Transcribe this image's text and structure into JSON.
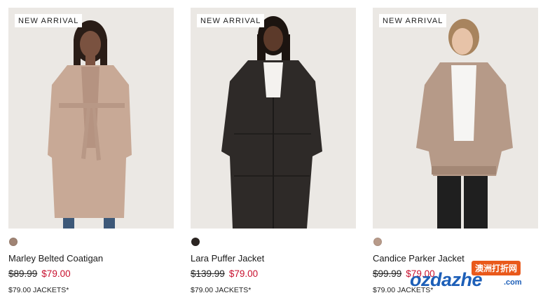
{
  "products": [
    {
      "badge": "NEW ARRIVAL",
      "name": "Marley Belted Coatigan",
      "was_price": "$89.99",
      "sale_price": "$79.00",
      "promo": "$79.00 JACKETS*",
      "swatch_color": "#a08474",
      "garment_color": "#c8a996"
    },
    {
      "badge": "NEW ARRIVAL",
      "name": "Lara Puffer Jacket",
      "was_price": "$139.99",
      "sale_price": "$79.00",
      "promo": "$79.00 JACKETS*",
      "swatch_color": "#2b2522",
      "garment_color": "#2e2a28"
    },
    {
      "badge": "NEW ARRIVAL",
      "name": "Candice Parker Jacket",
      "was_price": "$99.99",
      "sale_price": "$79.00",
      "promo": "$79.00 JACKETS*",
      "swatch_color": "#b89b8a",
      "garment_color": "#b69a88"
    }
  ],
  "watermark": {
    "cn": "澳洲打折网",
    "main": "ozdazhe",
    "domain": ".com"
  },
  "colors": {
    "sale_red": "#c8102e",
    "watermark_blue": "#1d5fb8",
    "watermark_orange": "#e9591b"
  }
}
